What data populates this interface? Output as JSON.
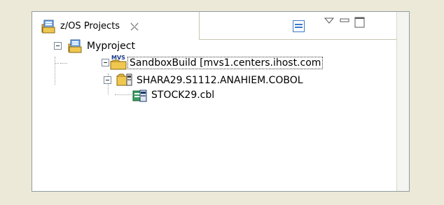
{
  "view": {
    "tab_label": "z/OS Projects",
    "tab_icon": "zos-projects-icon",
    "close_icon": "close-icon"
  },
  "toolbar": {
    "collapse_icon": "collapse-all-icon",
    "menu_icon": "view-menu-icon",
    "minimize_icon": "minimize-icon",
    "maximize_icon": "maximize-icon"
  },
  "tree": {
    "project": {
      "label": "Myproject",
      "icon": "project-icon"
    },
    "subproject": {
      "label": "SandboxBuild  [mvs1.centers.ihost.com",
      "icon": "mvs-subproject-icon"
    },
    "dataset": {
      "label": "SHARA29.S1112.ANAHIEM.COBOL",
      "icon": "pds-folder-icon"
    },
    "member": {
      "label": "STOCK29.cbl",
      "icon": "cobol-file-icon"
    }
  },
  "colors": {
    "frame_bg": "#ece9d8",
    "border": "#919b9c",
    "accent_blue": "#3a6ea5"
  }
}
